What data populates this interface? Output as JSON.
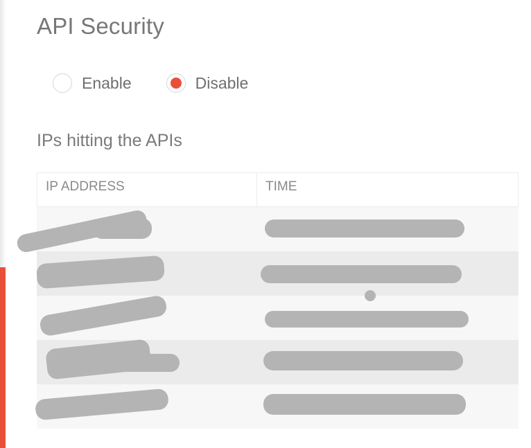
{
  "page": {
    "title": "API Security"
  },
  "api_security": {
    "options": [
      {
        "label": "Enable",
        "selected": false
      },
      {
        "label": "Disable",
        "selected": true
      }
    ],
    "accent_color": "#e8503a"
  },
  "ips_section": {
    "heading": "IPs hitting the APIs",
    "columns": [
      "IP ADDRESS",
      "TIME"
    ],
    "rows": [
      {
        "ip": "",
        "time": "",
        "redacted": true
      },
      {
        "ip": "",
        "time": "",
        "redacted": true
      },
      {
        "ip": "",
        "time": "",
        "redacted": true
      },
      {
        "ip": "",
        "time": "",
        "redacted": true
      },
      {
        "ip": "",
        "time": "",
        "redacted": true
      }
    ]
  }
}
